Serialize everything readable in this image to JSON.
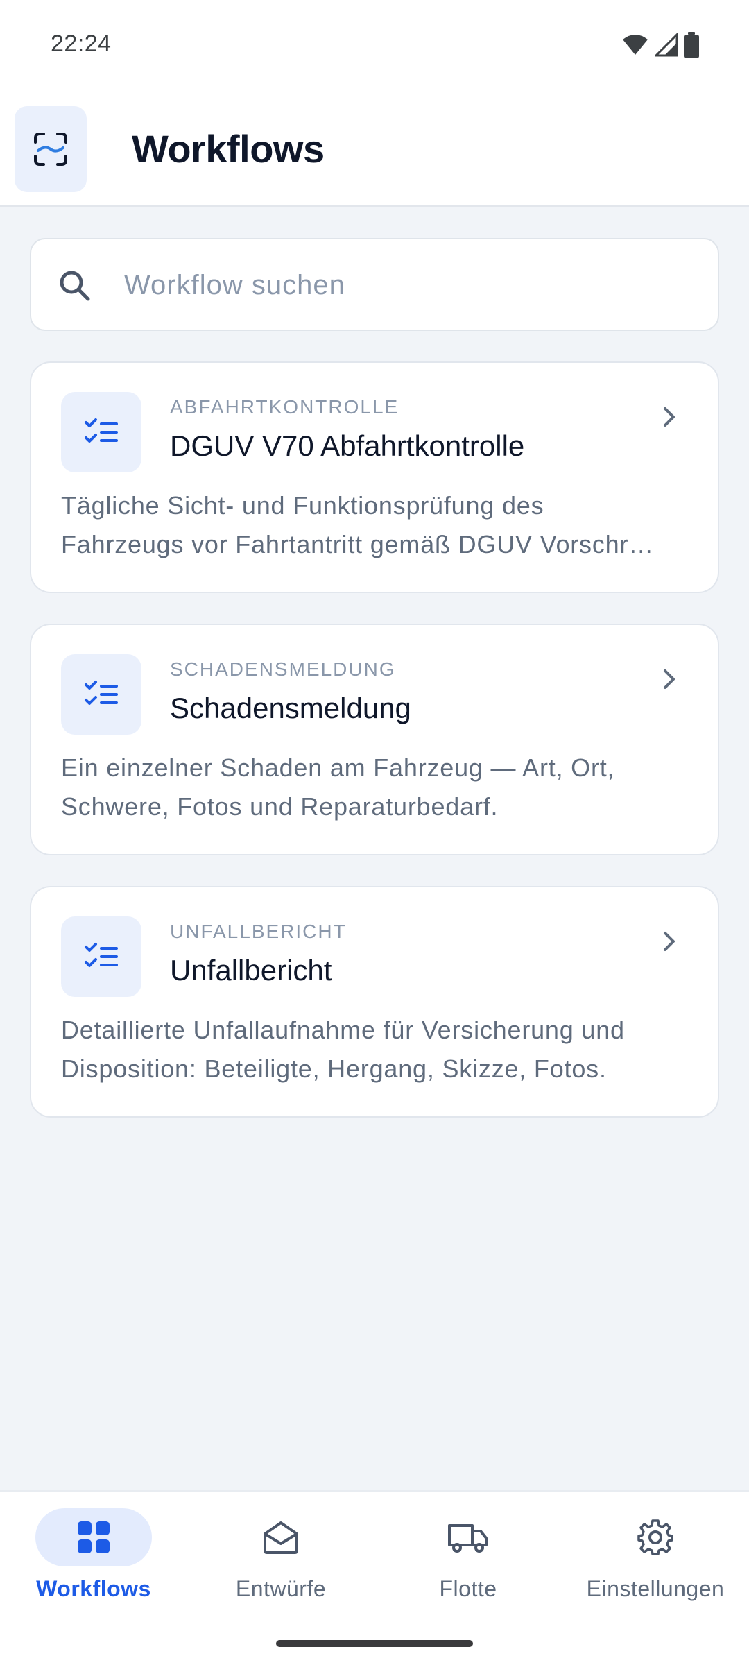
{
  "status_bar": {
    "time": "22:24",
    "icons": [
      "wifi-icon",
      "signal-icon",
      "battery-icon"
    ]
  },
  "app_bar": {
    "title": "Workflows",
    "logo_icon": "scan-frame-icon"
  },
  "search": {
    "placeholder": "Workflow suchen",
    "value": "",
    "icon": "search-icon"
  },
  "workflows": [
    {
      "category": "ABFAHRTKONTROLLE",
      "title": "DGUV V70 Abfahrtkontrolle",
      "description_line1": "Tägliche Sicht- und Funktionsprüfung des",
      "description_line2": "Fahrzeugs vor Fahrtantritt gemäß DGUV Vorschr…",
      "icon": "checklist-icon"
    },
    {
      "category": "SCHADENSMELDUNG",
      "title": "Schadensmeldung",
      "description_line1": "Ein einzelner Schaden am Fahrzeug — Art, Ort,",
      "description_line2": "Schwere, Fotos und Reparaturbedarf.",
      "icon": "checklist-icon"
    },
    {
      "category": "UNFALLBERICHT",
      "title": "Unfallbericht",
      "description_line1": "Detaillierte Unfallaufnahme für Versicherung und",
      "description_line2": "Disposition: Beteiligte, Hergang, Skizze, Fotos.",
      "icon": "checklist-icon"
    }
  ],
  "bottom_nav": {
    "items": [
      {
        "label": "Workflows",
        "icon": "grid-icon",
        "active": true
      },
      {
        "label": "Entwürfe",
        "icon": "envelope-open-icon",
        "active": false
      },
      {
        "label": "Flotte",
        "icon": "truck-icon",
        "active": false
      },
      {
        "label": "Einstellungen",
        "icon": "gear-icon",
        "active": false
      }
    ]
  },
  "colors": {
    "accent": "#1d5be6",
    "background": "#f1f4f8",
    "card": "#ffffff",
    "icon_bg": "#eaf0fc",
    "muted_text": "#8a97aa"
  }
}
